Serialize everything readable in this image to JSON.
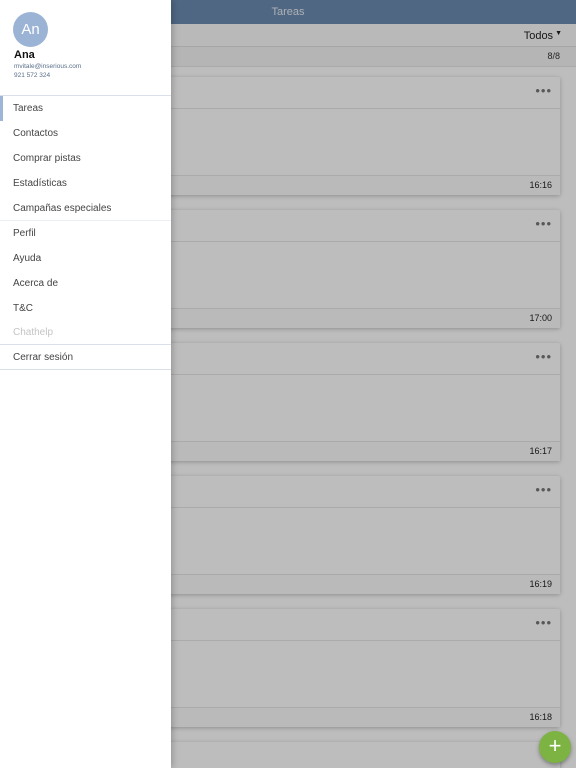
{
  "header": {
    "title": "Tareas"
  },
  "filter": {
    "selected": "Todos",
    "count": "8/8"
  },
  "tasks": [
    {
      "time": "16:16"
    },
    {
      "time": "17:00"
    },
    {
      "time": "16:17"
    },
    {
      "time": "16:19"
    },
    {
      "time": "16:18"
    }
  ],
  "fab": {
    "icon": "plus-icon",
    "symbol": "+"
  },
  "user": {
    "initials": "An",
    "name": "Ana",
    "email": "mvitale@inserious.com",
    "phone": "921 572 324"
  },
  "menu": {
    "items": [
      {
        "label": "Tareas"
      },
      {
        "label": "Contactos"
      },
      {
        "label": "Comprar pistas"
      },
      {
        "label": "Estadísticas"
      },
      {
        "label": "Campañas especiales"
      },
      {
        "label": "Perfil"
      },
      {
        "label": "Ayuda"
      },
      {
        "label": "Acerca de"
      },
      {
        "label": "T&C"
      },
      {
        "label": "Chathelp"
      },
      {
        "label": "Cerrar sesión"
      }
    ]
  },
  "colors": {
    "header": "#6b8bb0",
    "avatar": "#9bb4d6",
    "fab": "#7cb342",
    "active_indicator": "#9fb5d6"
  }
}
